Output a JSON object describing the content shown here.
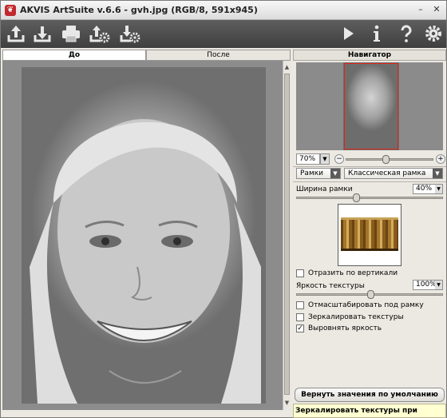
{
  "window": {
    "title": "AKVIS ArtSuite v.6.6 - gvh.jpg (RGB/8, 591x945)",
    "icon_glyph": "❦",
    "minimize_glyph": "–",
    "close_glyph": "✕"
  },
  "toolbar": {
    "left": [
      {
        "name": "open-icon"
      },
      {
        "name": "save-icon"
      },
      {
        "name": "print-icon"
      },
      {
        "name": "upload-settings-icon"
      },
      {
        "name": "download-settings-icon"
      }
    ],
    "right": [
      {
        "name": "run-icon"
      },
      {
        "name": "info-icon"
      },
      {
        "name": "help-icon"
      },
      {
        "name": "settings-gear-icon"
      }
    ]
  },
  "tabs": {
    "before": "До",
    "after": "После"
  },
  "navigator": {
    "title": "Навигатор",
    "zoom_value": "70%",
    "zoom_minus": "−",
    "zoom_plus": "+",
    "zoom_slider_fraction": 0.45
  },
  "effect": {
    "category": "Рамки",
    "preset": "Классическая рамка",
    "frame_width_label": "Ширина рамки",
    "frame_width_value": "40%",
    "flip_vertical_label": "Отразить по вертикали",
    "flip_vertical_checked": false,
    "texture_brightness_label": "Яркость текстуры",
    "texture_brightness_value": "100%",
    "scale_to_frame_label": "Отмасштабировать под рамку",
    "scale_to_frame_checked": false,
    "mirror_textures_label": "Зеркалировать текстуры",
    "mirror_textures_checked": false,
    "equalize_brightness_label": "Выровнять яркость",
    "equalize_brightness_checked": true
  },
  "reset_button": "Вернуть значения по умолчанию",
  "hint": "Зеркалировать текстуры при составлении",
  "check_glyph": "✓",
  "dropdown_glyph": "▼",
  "scroll_up": "▲",
  "scroll_down": "▼"
}
